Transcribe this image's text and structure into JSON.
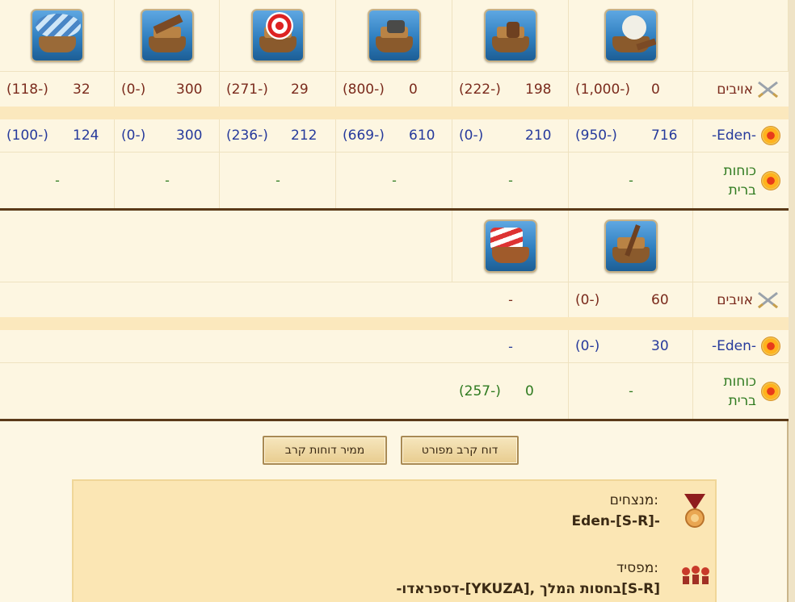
{
  "units_top": [
    {
      "name": "paddle-steamer-icon"
    },
    {
      "name": "ram-ship-icon"
    },
    {
      "name": "mortar-ship-icon"
    },
    {
      "name": "rocket-ship-icon"
    },
    {
      "name": "catapult-ship-icon"
    },
    {
      "name": "balloon-carrier-icon"
    }
  ],
  "units_bottom": [
    {
      "name": "tender-icon"
    },
    {
      "name": "diving-boat-icon"
    }
  ],
  "labels": {
    "enemies": "אויבים",
    "own": "-Eden-",
    "allies_line1": "כוחות",
    "allies_line2": "ברית"
  },
  "top_table": {
    "enemies": [
      {
        "count": "0",
        "loss": "(1,000-)"
      },
      {
        "count": "198",
        "loss": "(222-)"
      },
      {
        "count": "0",
        "loss": "(800-)"
      },
      {
        "count": "29",
        "loss": "(271-)"
      },
      {
        "count": "300",
        "loss": "(0-)"
      },
      {
        "count": "32",
        "loss": "(118-)"
      }
    ],
    "own": [
      {
        "count": "716",
        "loss": "(950-)"
      },
      {
        "count": "210",
        "loss": "(0-)"
      },
      {
        "count": "610",
        "loss": "(669-)"
      },
      {
        "count": "212",
        "loss": "(236-)"
      },
      {
        "count": "300",
        "loss": "(0-)"
      },
      {
        "count": "124",
        "loss": "(100-)"
      }
    ],
    "allies": [
      "-",
      "-",
      "-",
      "-",
      "-",
      "-"
    ]
  },
  "bottom_table": {
    "enemies": [
      {
        "count": "60",
        "loss": "(0-)"
      },
      {
        "dash": "-"
      }
    ],
    "own": [
      {
        "count": "30",
        "loss": "(0-)"
      },
      {
        "dash": "-"
      }
    ],
    "allies": [
      {
        "dash": "-"
      },
      {
        "count": "0",
        "loss": "(257-)"
      }
    ]
  },
  "buttons": {
    "detailed_report": "דוח קרב מפורט",
    "report_converter": "ממיר דוחות קרב"
  },
  "result": {
    "winners_title": "מנצחים:",
    "winners_value": "Eden-[S-R]-",
    "loser_title": "מפסיד:",
    "loser_value": "-דספראדו-[YKUZA], בחסות המלך[S-R]"
  },
  "colors": {
    "enemy_text": "#7a2a1c",
    "own_text": "#263a9c",
    "ally_text": "#2e7a1f",
    "separator": "#5b3a19",
    "band": "#fbe8bd"
  }
}
